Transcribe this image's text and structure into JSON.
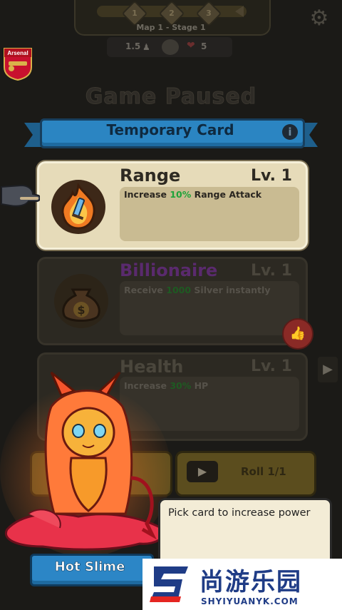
{
  "hud": {
    "stage": "Map 1 - Stage 1",
    "stage_nodes": [
      "1",
      "2",
      "3"
    ],
    "speed": "1.5",
    "hp": "5"
  },
  "team_badge": "Arsenal",
  "paused_title": "Game Paused",
  "banner": {
    "title": "Temporary Card",
    "info_icon": "i"
  },
  "cards": [
    {
      "title": "Range",
      "level": "Lv. 1",
      "desc_pre": "Increase ",
      "desc_value": "10%",
      "desc_post": " Range Attack",
      "icon": "flame-sword-icon",
      "selected": true
    },
    {
      "title": "Billionaire",
      "level": "Lv. 1",
      "desc_pre": "Receive ",
      "desc_value": "1000",
      "desc_post": " Silver instantly",
      "icon": "money-bag-icon",
      "selected": false
    },
    {
      "title": "Health",
      "level": "Lv. 1",
      "desc_pre": "Increase ",
      "desc_value": "30%",
      "desc_post": " HP",
      "icon": "heart-icon",
      "selected": false
    }
  ],
  "roll_label": "Roll 1/1",
  "tooltip": "Pick card to increase power",
  "character_name": "Hot Slime",
  "watermark": {
    "cn": "尚游乐园",
    "en": "SHYIYUANYK.COM"
  },
  "colors": {
    "accent_blue": "#2b85c2",
    "highlight_green": "#1fa33a",
    "billionaire_purple": "#5a2a6e",
    "card_cream": "#e6dbb9"
  }
}
